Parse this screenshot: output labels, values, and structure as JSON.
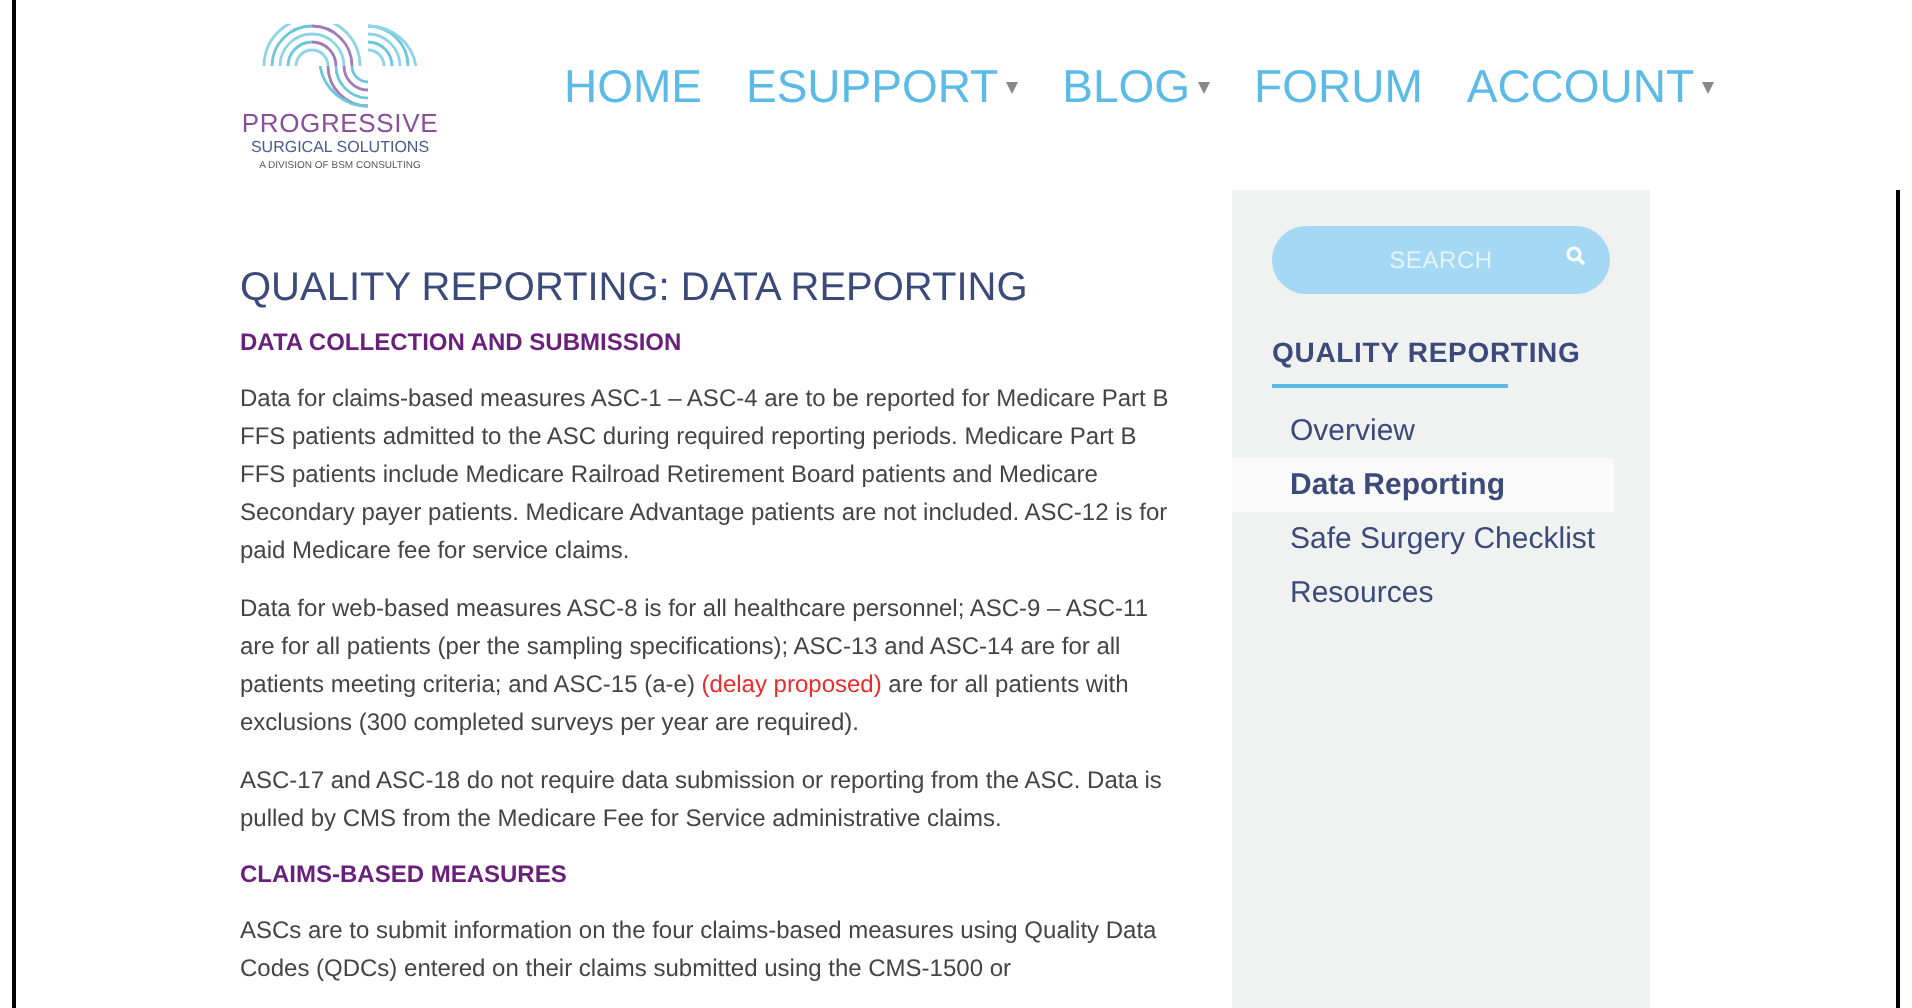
{
  "logo": {
    "name": "PROGRESSIVE",
    "subtitle": "SURGICAL SOLUTIONS",
    "tagline": "A DIVISION OF BSM CONSULTING"
  },
  "nav": [
    {
      "label": "HOME",
      "dropdown": false
    },
    {
      "label": "ESUPPORT",
      "dropdown": true
    },
    {
      "label": "BLOG",
      "dropdown": true
    },
    {
      "label": "FORUM",
      "dropdown": false
    },
    {
      "label": "ACCOUNT",
      "dropdown": true
    }
  ],
  "page_title": "QUALITY REPORTING: DATA REPORTING",
  "sections": [
    {
      "heading": "DATA COLLECTION AND SUBMISSION",
      "paragraphs": [
        [
          {
            "kind": "plain",
            "text": "Data for claims-based measures ASC-1 – ASC-4 are to be reported for Medicare Part B FFS patients admitted to the ASC during required reporting periods. Medicare Part B FFS patients include Medicare Railroad Retirement Board patients and Medicare Secondary payer patients. Medicare Advantage patients are not included. ASC-12 is for paid Medicare fee for service claims."
          }
        ],
        [
          {
            "kind": "plain",
            "text": "Data for web-based measures ASC-8 is for all healthcare personnel; ASC-9 – ASC-11 are for all patients (per the sampling specifications); ASC-13 and ASC-14 are for all patients meeting criteria; and ASC-15 (a-e) "
          },
          {
            "kind": "alert",
            "text": "(delay proposed)"
          },
          {
            "kind": "plain",
            "text": " are for all patients with exclusions (300 completed surveys per year are required)."
          }
        ],
        [
          {
            "kind": "plain",
            "text": "ASC-17 and ASC-18 do not require data submission or reporting from the ASC. Data is pulled by CMS from the Medicare Fee for Service administrative claims."
          }
        ]
      ]
    },
    {
      "heading": "CLAIMS-BASED MEASURES",
      "paragraphs": [
        [
          {
            "kind": "plain",
            "text": "ASCs are to submit information on the four claims-based measures using Quality Data Codes (QDCs) entered on their claims submitted using the CMS-1500 or"
          }
        ]
      ]
    }
  ],
  "sidebar": {
    "search": {
      "placeholder": "SEARCH"
    },
    "heading": "QUALITY REPORTING",
    "items": [
      {
        "label": "Overview",
        "selected": false
      },
      {
        "label": "Data Reporting",
        "selected": true
      },
      {
        "label": "Safe Surgery Checklist",
        "selected": false
      },
      {
        "label": "Resources",
        "selected": false
      }
    ]
  }
}
